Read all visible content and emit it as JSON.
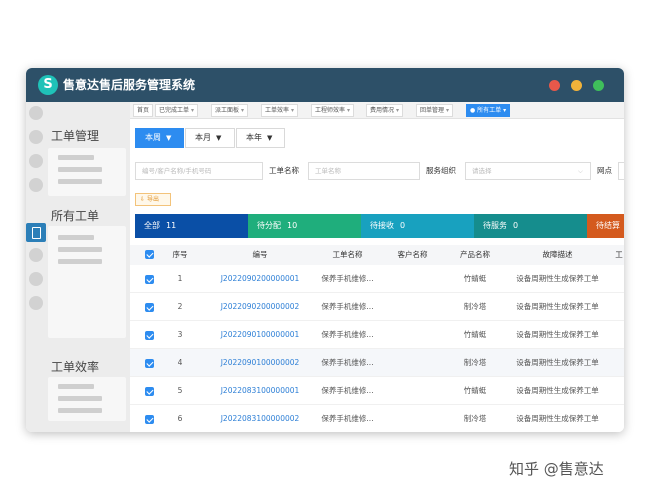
{
  "app": {
    "title": "售意达售后服务管理系统",
    "logo_letter": "S",
    "window_controls": [
      "#e8584a",
      "#f2b33a",
      "#3fbf5b"
    ]
  },
  "sidebar": {
    "sections": [
      {
        "title": "工单管理"
      },
      {
        "title": "所有工单"
      },
      {
        "title": "工单效率"
      }
    ],
    "icons": [
      "circle-icon",
      "circle-icon",
      "circle-icon",
      "circle-icon",
      "document-icon",
      "circle-icon",
      "circle-icon",
      "circle-icon"
    ]
  },
  "tabs": [
    {
      "label": "首页",
      "closable": false
    },
    {
      "label": "已完成工单",
      "closable": true
    },
    {
      "label": "派工面板",
      "closable": true
    },
    {
      "label": "工单效率",
      "closable": true
    },
    {
      "label": "工程师效率",
      "closable": true
    },
    {
      "label": "费用情况",
      "closable": true
    },
    {
      "label": "回单管理",
      "closable": true
    },
    {
      "label": "所有工单",
      "closable": true,
      "active": true
    }
  ],
  "period_buttons": [
    {
      "label": "本周",
      "active": true
    },
    {
      "label": "本月",
      "active": false
    },
    {
      "label": "本年",
      "active": false
    }
  ],
  "filters": {
    "search_placeholder": "编号/客户名称/手机号码",
    "order_name_label": "工单名称",
    "order_name_placeholder": "工单名称",
    "org_label": "服务组织",
    "org_placeholder": "请选择",
    "site_label": "网点"
  },
  "export_label": "导出",
  "status_tabs": [
    {
      "label": "全部",
      "count": "11",
      "color": "#0a4fa6"
    },
    {
      "label": "待分配",
      "count": "10",
      "color": "#1fae7c"
    },
    {
      "label": "待接收",
      "count": "0",
      "color": "#18a1bf"
    },
    {
      "label": "待服务",
      "count": "0",
      "color": "#158d8d"
    },
    {
      "label": "待结算",
      "count": "",
      "color": "#d45a1e"
    }
  ],
  "table": {
    "headers": [
      "序号",
      "编号",
      "工单名称",
      "客户名称",
      "产品名称",
      "故障描述",
      "工"
    ],
    "rows": [
      {
        "seq": "1",
        "code": "J2022090200000001",
        "name": "保养手机维修...",
        "customer": "",
        "product": "竹蜻蜓",
        "fault": "设备周期性生成保养工单"
      },
      {
        "seq": "2",
        "code": "J2022090200000002",
        "name": "保养手机维修...",
        "customer": "",
        "product": "制冷塔",
        "fault": "设备周期性生成保养工单"
      },
      {
        "seq": "3",
        "code": "J2022090100000001",
        "name": "保养手机维修...",
        "customer": "",
        "product": "竹蜻蜓",
        "fault": "设备周期性生成保养工单"
      },
      {
        "seq": "4",
        "code": "J2022090100000002",
        "name": "保养手机维修...",
        "customer": "",
        "product": "制冷塔",
        "fault": "设备周期性生成保养工单"
      },
      {
        "seq": "5",
        "code": "J2022083100000001",
        "name": "保养手机维修...",
        "customer": "",
        "product": "竹蜻蜓",
        "fault": "设备周期性生成保养工单"
      },
      {
        "seq": "6",
        "code": "J2022083100000002",
        "name": "保养手机维修...",
        "customer": "",
        "product": "制冷塔",
        "fault": "设备周期性生成保养工单"
      }
    ]
  },
  "watermark": "知乎 @售意达",
  "colors": {
    "titlebar": "#2d5068",
    "accent": "#2d8cf0",
    "link": "#2d7fd6",
    "sidebar_active": "#2c7fb8"
  }
}
